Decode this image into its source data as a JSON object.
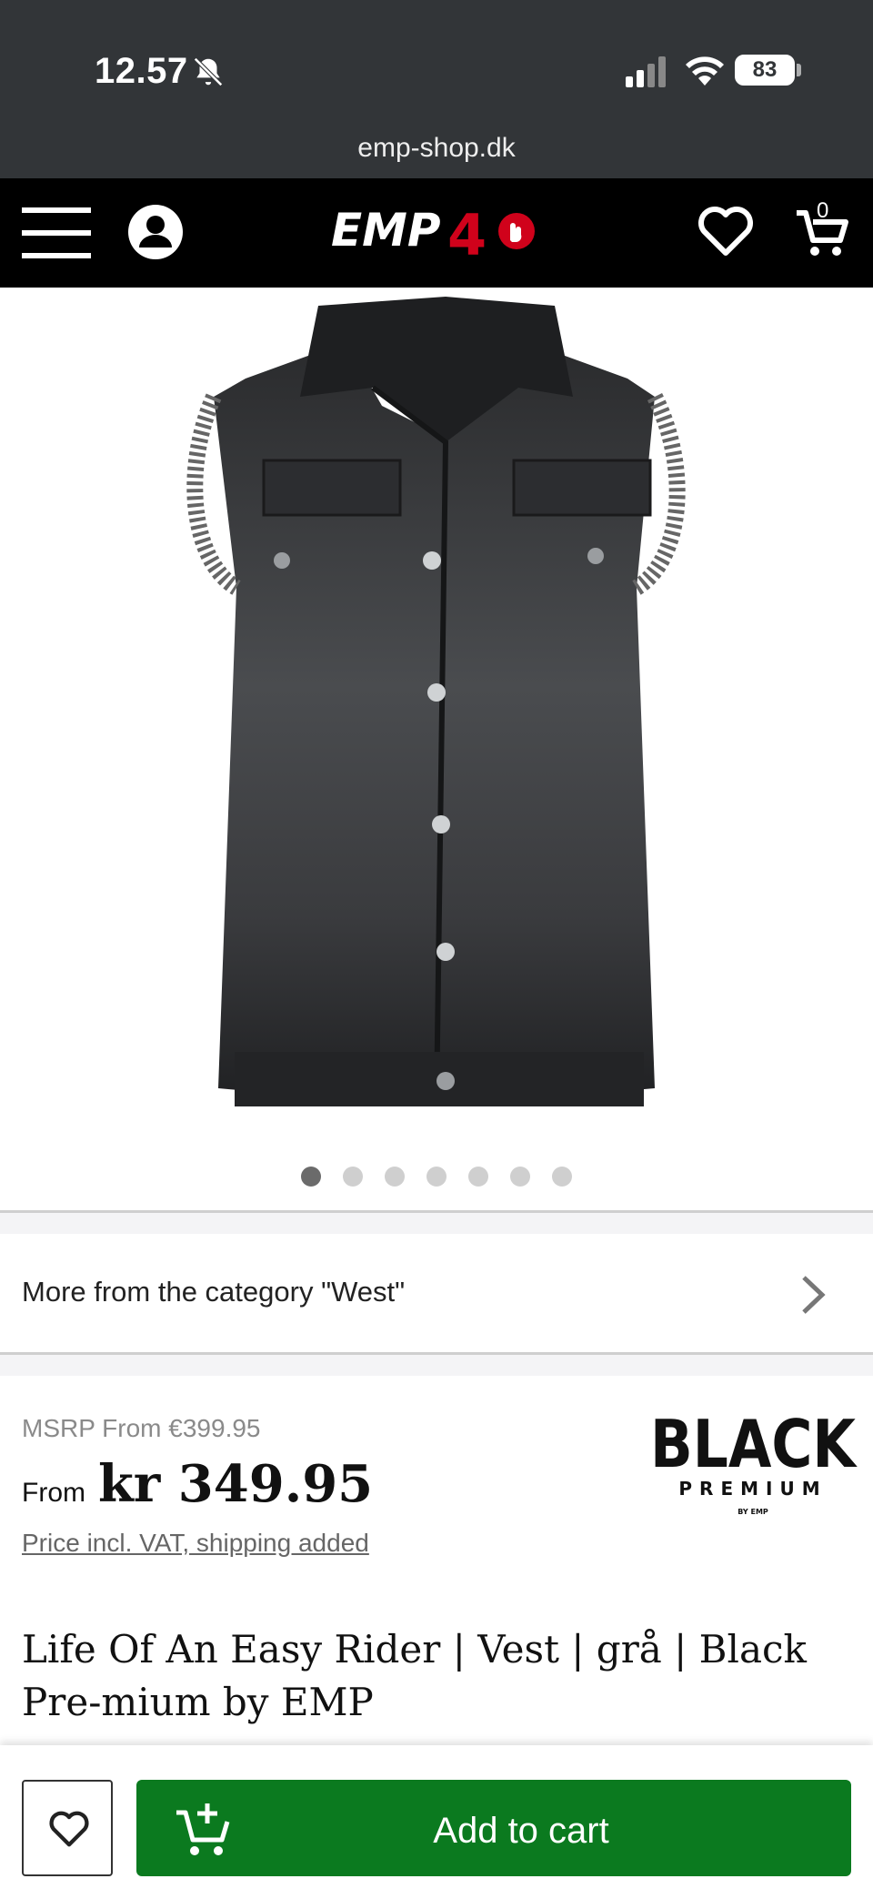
{
  "status_bar": {
    "time": "12.57",
    "battery": "83",
    "url": "emp-shop.dk"
  },
  "nav": {
    "logo_text": "EMP40",
    "cart_count": "0"
  },
  "gallery": {
    "image_count": 7,
    "active_index": 0
  },
  "category_link": {
    "label": "More from the category \"West\""
  },
  "pricing": {
    "msrp": "MSRP From €399.95",
    "from_label": "From",
    "price": "kr 349.95",
    "vat_note": "Price incl. VAT, shipping added"
  },
  "brand": {
    "name": "BLACK",
    "sub": "PREMIUM",
    "by": "BY EMP"
  },
  "product": {
    "title": "Life Of An Easy Rider | Vest | grå | Black Pre-mium by EMP"
  },
  "actions": {
    "add_to_cart": "Add to cart"
  },
  "colors": {
    "status_bg": "#323538",
    "nav_bg": "#000000",
    "cart_button": "#0b7a1f",
    "logo_red": "#d0021b"
  }
}
